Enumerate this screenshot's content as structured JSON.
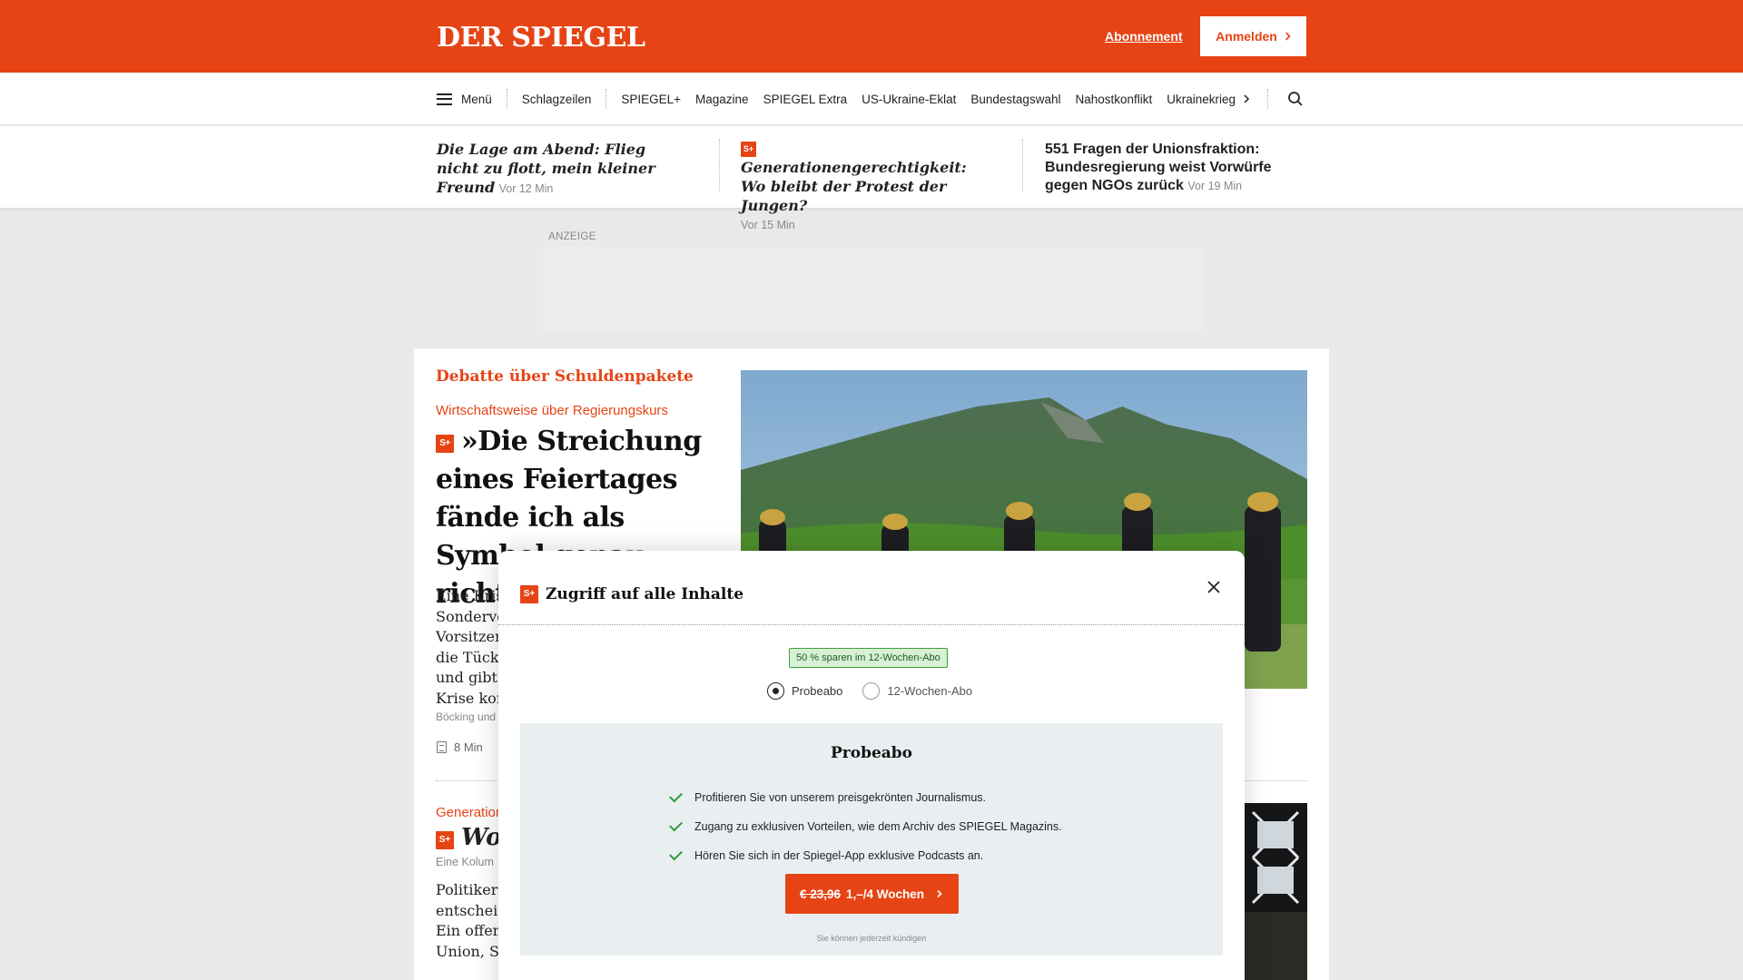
{
  "header": {
    "logo": "DER SPIEGEL",
    "abo_link": "Abonnement",
    "login_label": "Anmelden",
    "brand_color": "#e64415"
  },
  "nav": {
    "menu_label": "Menü",
    "items": [
      "Schlagzeilen",
      "SPIEGEL+",
      "Magazine",
      "SPIEGEL Extra",
      "US-Ukraine-Eklat",
      "Bundestagswahl",
      "Nahostkonflikt",
      "Ukrainekrieg"
    ],
    "more_icon": "chevron-right-icon",
    "search_icon": "search-icon"
  },
  "teasers": [
    {
      "title": "Die Lage am Abend: Flieg nicht zu flott, mein kleiner Freund",
      "age": "Vor 12 Min",
      "plus": false
    },
    {
      "title": "Generationengerechtigkeit: Wo bleibt der Protest der Jungen?",
      "age": "Vor 15 Min",
      "plus": true
    },
    {
      "title": "551 Fragen der Unionsfraktion: Bundesregierung weist Vorwürfe gegen NGOs zurück",
      "age": "Vor 19 Min",
      "plus": false
    }
  ],
  "ad": {
    "label": "ANZEIGE"
  },
  "main_article": {
    "kicker": "Debatte über Schuldenpakete",
    "subkicker": "Wirtschaftsweise über Regierungskurs",
    "plus_badge": "S+",
    "headline": "»Die Streichung eines Feiertages fände ich als Symbol genau richtig«",
    "teaser_lines": [
      "Eine Krise",
      "Sonderve",
      "Vorsitzen",
      "die Tücke",
      "und gibt T",
      "Krise kom"
    ],
    "author": "Böcking und",
    "read_time": "8 Min"
  },
  "second_article": {
    "kicker": "Generation",
    "headline": "Wo",
    "sub": "Eine Kolum",
    "teaser_lines": [
      "Politiker u",
      "entscheid",
      "Ein offene",
      "Union, SP"
    ]
  },
  "modal": {
    "title": "Zugriff auf alle Inhalte",
    "plus_badge": "S+",
    "save_badge": "50 % sparen im 12-Wochen-Abo",
    "options": [
      "Probeabo",
      "12-Wochen-Abo"
    ],
    "selected_option": "Probeabo",
    "plan_title": "Probeabo",
    "benefits": [
      "Profitieren Sie von unserem preisgekrönten Journalismus.",
      "Zugang zu exklusiven Vorteilen, wie dem Archiv des SPIEGEL Magazins.",
      "Hören Sie sich in der Spiegel-App exklusive Podcasts an."
    ],
    "cta_old_price": "€ 23,96",
    "cta_new_price": "1,–/4 Wochen",
    "cancel_note": "Sie können jederzeit kündigen",
    "check_color": "#2f9a39"
  }
}
